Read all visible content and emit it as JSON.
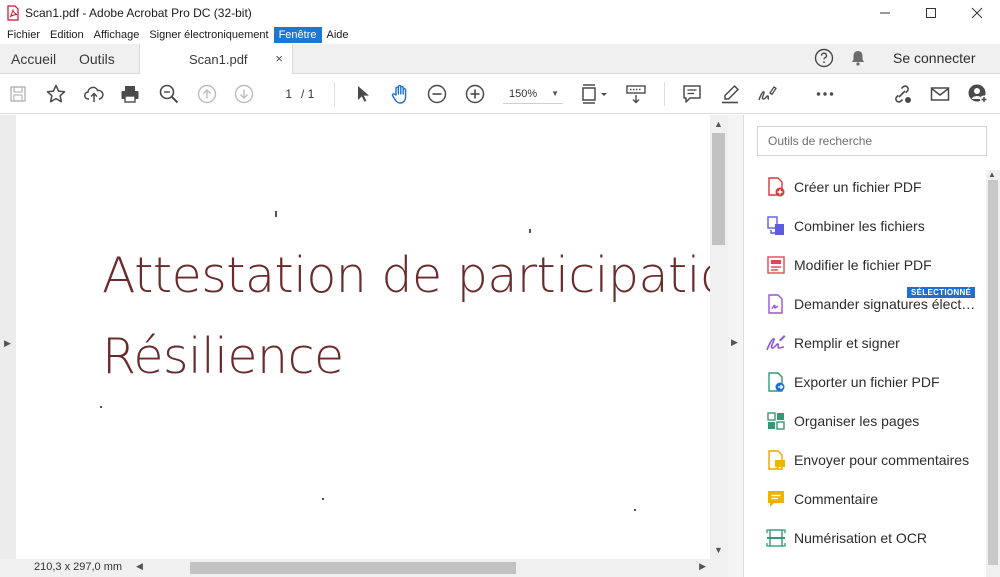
{
  "window": {
    "title": "Scan1.pdf - Adobe Acrobat Pro DC (32-bit)"
  },
  "menu": [
    {
      "label": "Fichier",
      "active": false
    },
    {
      "label": "Edition",
      "active": false
    },
    {
      "label": "Affichage",
      "active": false
    },
    {
      "label": "Signer électroniquement",
      "active": false
    },
    {
      "label": "Fenêtre",
      "active": true
    },
    {
      "label": "Aide",
      "active": false
    }
  ],
  "tabs": {
    "home": "Accueil",
    "tools": "Outils",
    "document": "Scan1.pdf",
    "close": "×"
  },
  "header": {
    "signin": "Se connecter"
  },
  "toolbar": {
    "page_current": "1",
    "page_total": "/ 1",
    "zoom": "150%"
  },
  "document": {
    "line1": "Attestation de participation",
    "line2": "Résilience",
    "page_size": "210,3 x 297,0 mm"
  },
  "right_pane": {
    "search_placeholder": "Outils de recherche",
    "badge": "SÉLECTIONNÉ",
    "tools": [
      {
        "label": "Créer un fichier PDF",
        "icon": "create-pdf-icon"
      },
      {
        "label": "Combiner les fichiers",
        "icon": "combine-files-icon"
      },
      {
        "label": "Modifier le fichier PDF",
        "icon": "edit-pdf-icon"
      },
      {
        "label": "Demander signatures élect…",
        "icon": "request-signatures-icon"
      },
      {
        "label": "Remplir et signer",
        "icon": "fill-sign-icon"
      },
      {
        "label": "Exporter un fichier PDF",
        "icon": "export-pdf-icon"
      },
      {
        "label": "Organiser les pages",
        "icon": "organize-pages-icon"
      },
      {
        "label": "Envoyer pour commentaires",
        "icon": "send-for-comments-icon"
      },
      {
        "label": "Commentaire",
        "icon": "comment-icon"
      },
      {
        "label": "Numérisation et OCR",
        "icon": "scan-ocr-icon"
      }
    ]
  },
  "colors": {
    "accent": "#1e78d2",
    "doc_text": "#6a2b2b"
  }
}
